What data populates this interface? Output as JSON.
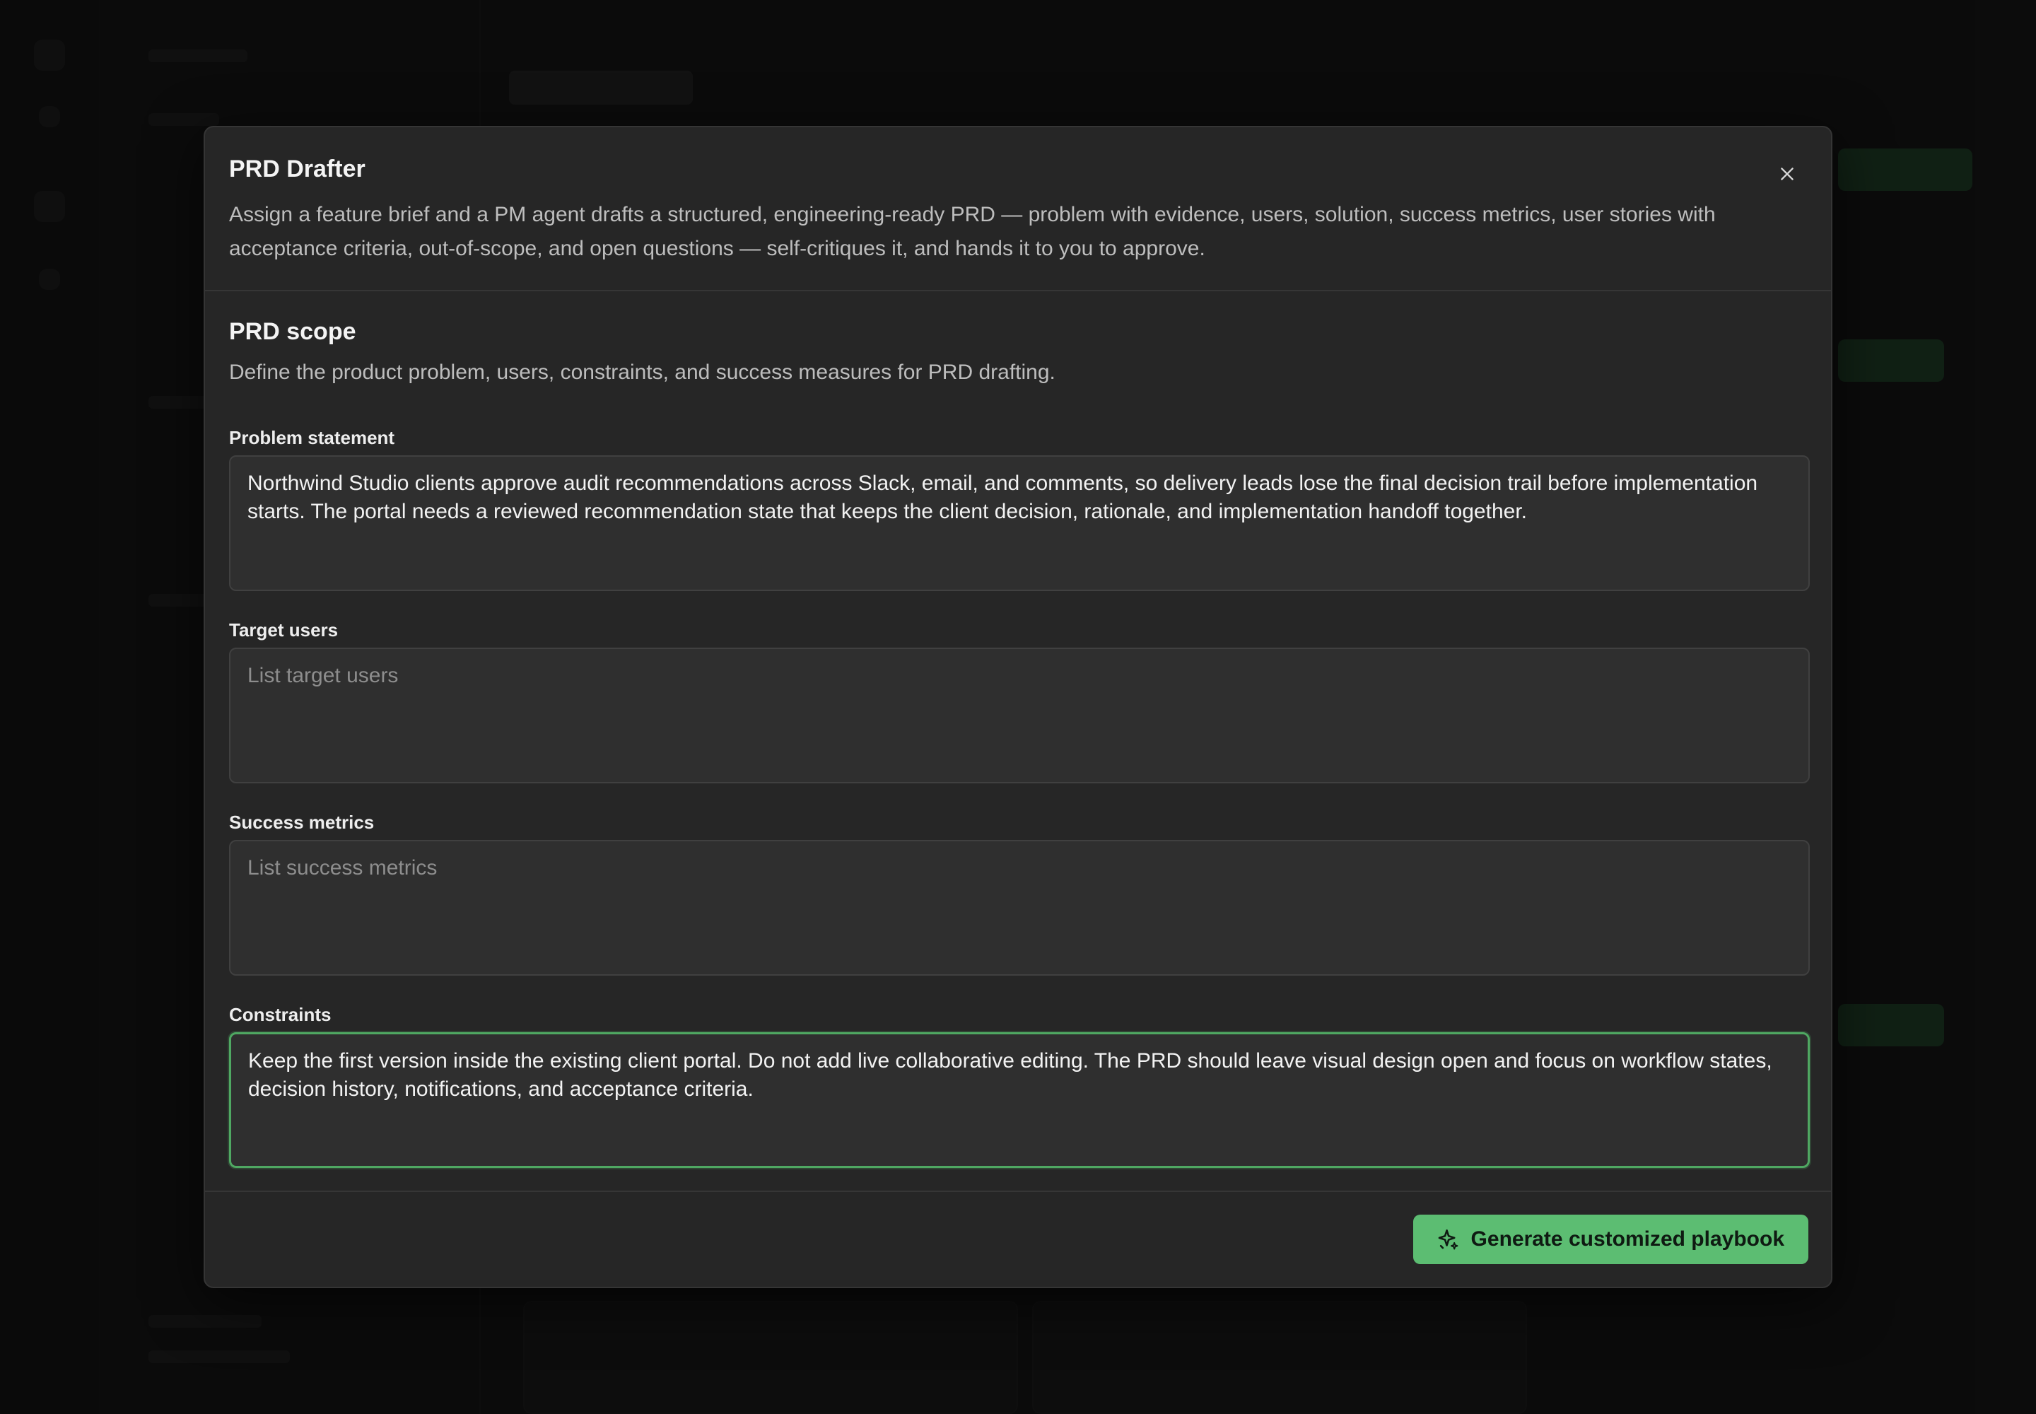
{
  "modal": {
    "title": "PRD Drafter",
    "description": "Assign a feature brief and a PM agent drafts a structured, engineering-ready PRD — problem with evidence, users, solution, success metrics, user stories with acceptance criteria, out-of-scope, and open questions — self-critiques it, and hands it to you to approve.",
    "close_icon": "close-icon"
  },
  "section": {
    "title": "PRD scope",
    "description": "Define the product problem, users, constraints, and success measures for PRD drafting."
  },
  "fields": {
    "problem": {
      "label": "Problem statement",
      "value": "Northwind Studio clients approve audit recommendations across Slack, email, and comments, so delivery leads lose the final decision trail before implementation starts. The portal needs a reviewed recommendation state that keeps the client decision, rationale, and implementation handoff together."
    },
    "users": {
      "label": "Target users",
      "placeholder": "List target users"
    },
    "metrics": {
      "label": "Success metrics",
      "placeholder": "List success metrics"
    },
    "constraints": {
      "label": "Constraints",
      "value": "Keep the first version inside the existing client portal. Do not add live collaborative editing. The PRD should leave visual design open and focus on workflow states, decision history, notifications, and acceptance criteria."
    }
  },
  "footer": {
    "generate_label": "Generate customized playbook",
    "generate_icon": "sparkle-icon"
  },
  "colors": {
    "accent": "#5cbd72",
    "focus_border": "#4fa862",
    "modal_bg": "#262626"
  }
}
